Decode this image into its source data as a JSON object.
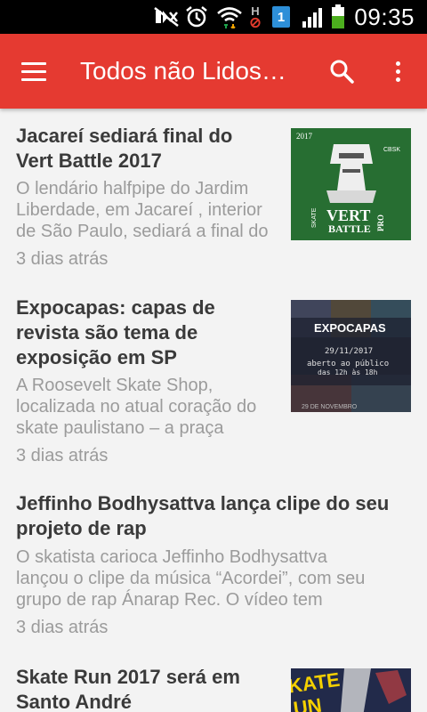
{
  "status_bar": {
    "time": "09:35",
    "sim_label": "1",
    "network_label": "H",
    "icons": [
      "mute-icon",
      "alarm-icon",
      "wifi-icon",
      "network-h-icon",
      "sim-icon",
      "signal-icon",
      "battery-icon"
    ]
  },
  "app_bar": {
    "title": "Todos não Lidos…",
    "menu_icon": "hamburger-menu-icon",
    "search_icon": "search-icon",
    "more_icon": "more-vert-icon",
    "color": "#e53a31"
  },
  "articles": [
    {
      "title_lines": [
        "Jacareí sediará final do",
        "Vert Battle 2017"
      ],
      "snippet_lines": [
        "O lendário halfpipe do Jardim",
        "Liberdade, em Jacareí , interior",
        "de São Paulo, sediará a final do"
      ],
      "time": "3 dias atrás",
      "thumbnail": {
        "year": "2017",
        "line1": "VERT",
        "line2": "BATTLE",
        "side_left": "SKATE",
        "side_right": "PRO",
        "corner": "CBSK"
      }
    },
    {
      "title_lines": [
        "Expocapas: capas de",
        "revista são tema de",
        "exposição em SP"
      ],
      "snippet_lines": [
        "A Roosevelt Skate Shop,",
        "localizada no atual coração do",
        "skate paulistano – a praça"
      ],
      "time": "3 dias atrás",
      "thumbnail": {
        "headline": "EXPOCAPAS",
        "date": "29/11/2017",
        "line1": "aberto ao público",
        "line2": "das 12h às 18h",
        "footer": "29 DE NOVEMBRO"
      }
    },
    {
      "title_lines": [
        "Jeffinho Bodhysattva lança clipe do seu",
        "projeto de rap"
      ],
      "snippet_lines": [
        "O skatista carioca Jeffinho Bodhysattva",
        "lançou o clipe da música “Acordei”, com seu",
        "grupo de rap Ánarap Rec. O vídeo tem"
      ],
      "time": "3 dias atrás",
      "thumbnail": null
    },
    {
      "title_lines": [
        "Skate Run 2017 será em",
        "Santo André"
      ],
      "snippet_lines": [],
      "time": "",
      "thumbnail": {
        "text": "KATE",
        "text2": "UN"
      }
    }
  ]
}
